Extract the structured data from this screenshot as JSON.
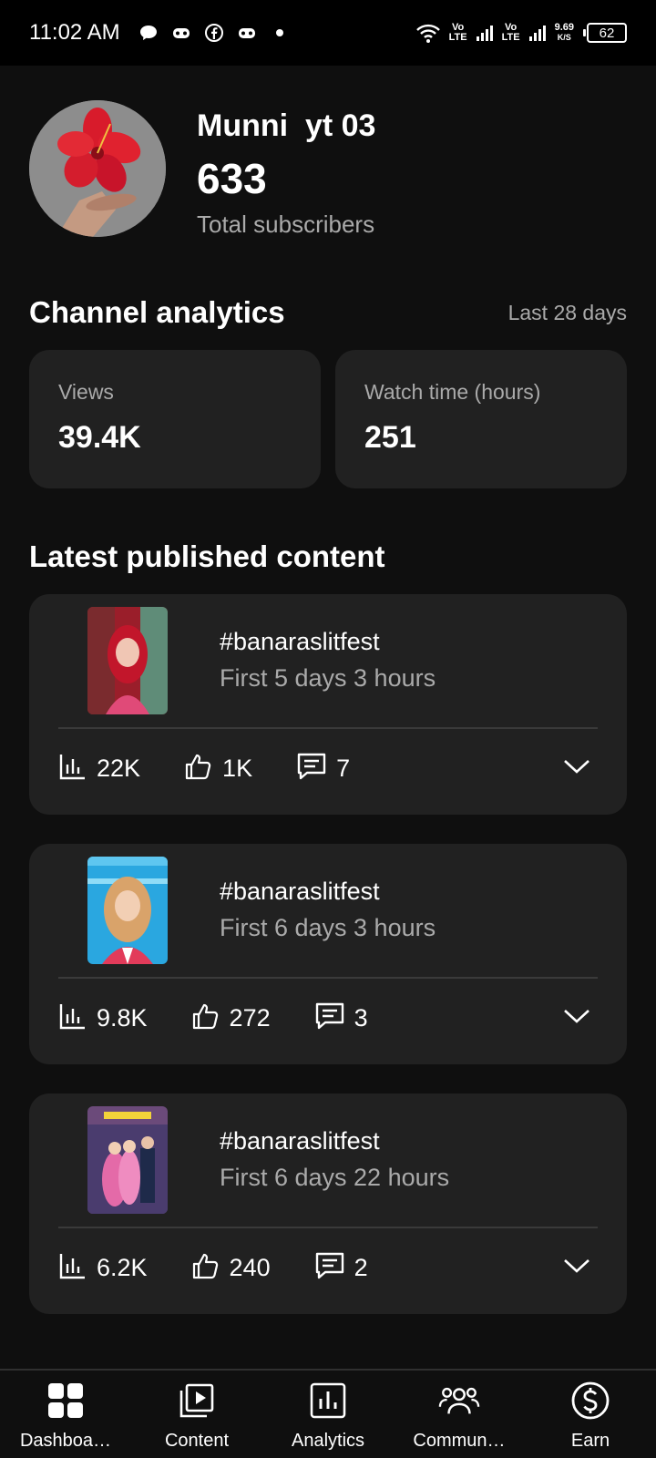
{
  "status_bar": {
    "time": "11:02 AM",
    "net1": "Vo\nLTE",
    "net2": "Vo\nLTE",
    "speed_value": "9.69",
    "speed_unit": "K/S",
    "battery": "62",
    "icons": [
      "message-icon",
      "game-icon",
      "facebook-icon",
      "game-icon",
      "dot-icon",
      "wifi-icon",
      "signal-icon",
      "signal-icon"
    ]
  },
  "profile": {
    "channel_name": "Munni  yt 03",
    "subscriber_count": "633",
    "subscriber_label": "Total subscribers"
  },
  "analytics": {
    "title": "Channel analytics",
    "period": "Last 28 days",
    "cards": [
      {
        "label": "Views",
        "value": "39.4K"
      },
      {
        "label": "Watch time (hours)",
        "value": "251"
      }
    ]
  },
  "latest": {
    "title": "Latest published content",
    "items": [
      {
        "title": "#banaraslitfest",
        "subtitle": "First 5 days 3 hours",
        "views": "22K",
        "likes": "1K",
        "comments": "7"
      },
      {
        "title": "#banaraslitfest",
        "subtitle": "First 6 days 3 hours",
        "views": "9.8K",
        "likes": "272",
        "comments": "3"
      },
      {
        "title": "#banaraslitfest",
        "subtitle": "First 6 days 22 hours",
        "views": "6.2K",
        "likes": "240",
        "comments": "2"
      }
    ]
  },
  "nav": {
    "items": [
      {
        "label": "Dashboa…",
        "icon": "dashboard-icon"
      },
      {
        "label": "Content",
        "icon": "content-icon"
      },
      {
        "label": "Analytics",
        "icon": "analytics-icon"
      },
      {
        "label": "Commun…",
        "icon": "community-icon"
      },
      {
        "label": "Earn",
        "icon": "earn-icon"
      }
    ]
  },
  "colors": {
    "background": "#0f0f0f",
    "card": "#212121",
    "secondary_text": "#aaaaaa",
    "status_bar": "#000000"
  }
}
